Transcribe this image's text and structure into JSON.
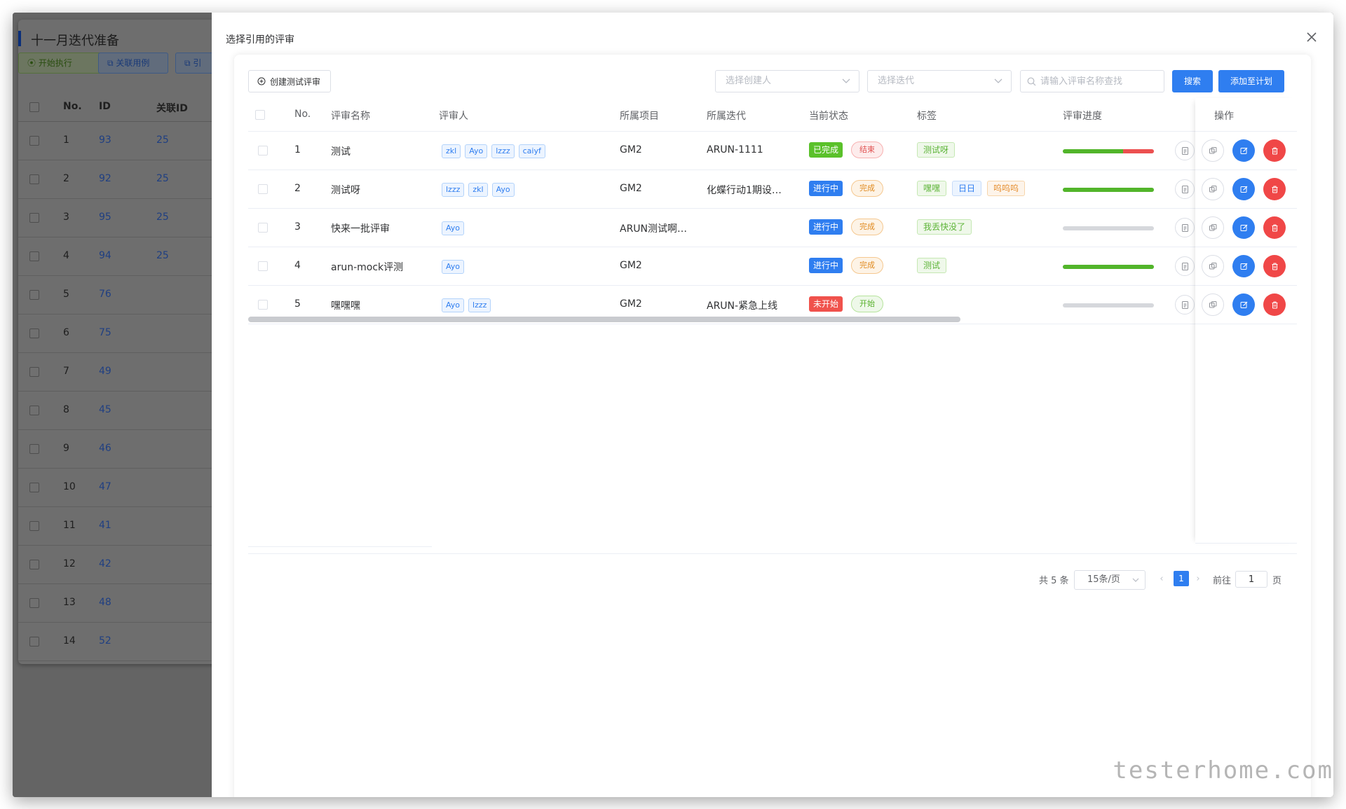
{
  "background": {
    "page_title": "十一月迭代准备",
    "buttons": {
      "start": "开始执行",
      "link_cases": "关联用例",
      "ref": "引"
    },
    "columns": {
      "no": "No.",
      "id": "ID",
      "related_id": "关联ID"
    },
    "rows": [
      {
        "no": "1",
        "id": "93",
        "related": "25"
      },
      {
        "no": "2",
        "id": "92",
        "related": "25"
      },
      {
        "no": "3",
        "id": "95",
        "related": "25"
      },
      {
        "no": "4",
        "id": "94",
        "related": "25"
      },
      {
        "no": "5",
        "id": "76",
        "related": ""
      },
      {
        "no": "6",
        "id": "75",
        "related": ""
      },
      {
        "no": "7",
        "id": "49",
        "related": ""
      },
      {
        "no": "8",
        "id": "45",
        "related": ""
      },
      {
        "no": "9",
        "id": "46",
        "related": ""
      },
      {
        "no": "10",
        "id": "47",
        "related": ""
      },
      {
        "no": "11",
        "id": "41",
        "related": ""
      },
      {
        "no": "12",
        "id": "42",
        "related": ""
      },
      {
        "no": "13",
        "id": "48",
        "related": ""
      },
      {
        "no": "14",
        "id": "52",
        "related": ""
      }
    ]
  },
  "modal": {
    "title": "选择引用的评审",
    "toolbar": {
      "create_label": "创建测试评审",
      "creator_placeholder": "选择创建人",
      "iteration_placeholder": "选择迭代",
      "search_placeholder": "请输入评审名称查找",
      "search_label": "搜索",
      "add_label": "添加至计划"
    },
    "columns": {
      "no": "No.",
      "name": "评审名称",
      "reviewers": "评审人",
      "project": "所属项目",
      "iteration": "所属迭代",
      "status": "当前状态",
      "tags": "标签",
      "progress": "评审进度",
      "actions": "操作"
    },
    "rows": [
      {
        "no": "1",
        "name": "测试",
        "reviewers": [
          "zkl",
          "Ayo",
          "lzzz",
          "caiyf"
        ],
        "project": "GM2",
        "iteration": "ARUN-1111",
        "status": "已完成",
        "status_type": "done",
        "result": "结束",
        "result_type": "red",
        "tags": [
          {
            "label": "测试呀",
            "color": "green"
          }
        ],
        "progress_green": 0.66,
        "progress_red": 0.34
      },
      {
        "no": "2",
        "name": "测试呀",
        "reviewers": [
          "lzzz",
          "zkl",
          "Ayo"
        ],
        "project": "GM2",
        "iteration": "化蝶行动1期设…",
        "status": "进行中",
        "status_type": "progress",
        "result": "完成",
        "result_type": "orange",
        "tags": [
          {
            "label": "嘿嘿",
            "color": "green"
          },
          {
            "label": "日日",
            "color": "blue"
          },
          {
            "label": "呜呜呜",
            "color": "orange"
          }
        ],
        "progress_green": 1.0,
        "progress_red": 0
      },
      {
        "no": "3",
        "name": "快来一批评审",
        "reviewers": [
          "Ayo"
        ],
        "project": "ARUN测试啊…",
        "iteration": "",
        "status": "进行中",
        "status_type": "progress",
        "result": "完成",
        "result_type": "orange",
        "tags": [
          {
            "label": "我丢快没了",
            "color": "green"
          }
        ],
        "progress_green": 0,
        "progress_red": 0
      },
      {
        "no": "4",
        "name": "arun-mock评测",
        "reviewers": [
          "Ayo"
        ],
        "project": "GM2",
        "iteration": "",
        "status": "进行中",
        "status_type": "progress",
        "result": "完成",
        "result_type": "orange",
        "tags": [
          {
            "label": "测试",
            "color": "green"
          }
        ],
        "progress_green": 1.0,
        "progress_red": 0
      },
      {
        "no": "5",
        "name": "嘿嘿嘿",
        "reviewers": [
          "Ayo",
          "lzzz"
        ],
        "project": "GM2",
        "iteration": "ARUN-紧急上线",
        "status": "未开始",
        "status_type": "notstart",
        "result": "开始",
        "result_type": "green",
        "tags": [],
        "progress_green": 0,
        "progress_red": 0
      }
    ],
    "pagination": {
      "total": "共 5 条",
      "page_size": "15条/页",
      "current": "1",
      "goto_label": "前往",
      "goto_value": "1",
      "page_unit": "页"
    }
  },
  "watermark": "testerhome.com",
  "colors": {
    "primary": "#2f7ef0",
    "success": "#5ac12a",
    "danger": "#f04747"
  }
}
